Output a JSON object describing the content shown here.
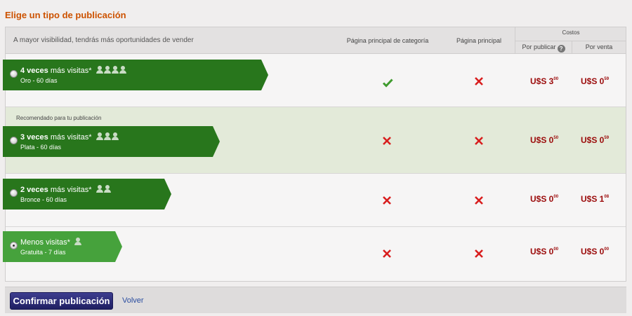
{
  "page": {
    "title": "Elige un tipo de publicación"
  },
  "header": {
    "description": "A mayor visibilidad, tendrás más oportunidades de vender",
    "col_category": "Página principal de categoría",
    "col_main": "Página principal",
    "costs_title": "Costos",
    "col_publish": "Por publicar",
    "col_publish_help": "?",
    "col_sale": "Por venta"
  },
  "rows": [
    {
      "bold": "4 veces",
      "rest": " más visitas*",
      "users": 4,
      "subtitle": "Oro - 60 días",
      "category_page": "check-icon",
      "main_page": "cross-icon",
      "publish_price": {
        "int": "U$S 3",
        "dec": "00"
      },
      "sale_price": {
        "int": "U$S 0",
        "dec": "59"
      },
      "selected": false
    },
    {
      "recommended": "Recomendado para tu publicación",
      "bold": "3 veces",
      "rest": " más visitas*",
      "users": 3,
      "subtitle": "Plata - 60 días",
      "category_page": "cross-icon",
      "main_page": "cross-icon",
      "publish_price": {
        "int": "U$S 0",
        "dec": "50"
      },
      "sale_price": {
        "int": "U$S 0",
        "dec": "59"
      },
      "selected": false
    },
    {
      "bold": "2 veces",
      "rest": " más visitas*",
      "users": 2,
      "subtitle": "Bronce - 60 días",
      "category_page": "cross-icon",
      "main_page": "cross-icon",
      "publish_price": {
        "int": "U$S 0",
        "dec": "00"
      },
      "sale_price": {
        "int": "U$S 1",
        "dec": "08"
      },
      "selected": false
    },
    {
      "bold": "",
      "rest": "Menos visitas*",
      "users": 1,
      "subtitle": "Gratuita - 7 días",
      "category_page": "cross-icon",
      "main_page": "cross-icon",
      "publish_price": {
        "int": "U$S 0",
        "dec": "00"
      },
      "sale_price": {
        "int": "U$S 0",
        "dec": "00"
      },
      "selected": true
    }
  ],
  "footer": {
    "confirm_label": "Confirmar publicación",
    "back_label": "Volver"
  },
  "colors": {
    "accent_title": "#cc5200",
    "ribbon_dark": "#28761c",
    "ribbon_light": "#46a23c",
    "price": "#9b0a0a",
    "check": "#3f9b2e",
    "cross": "#d81e1e",
    "button": "#2a2a78"
  }
}
